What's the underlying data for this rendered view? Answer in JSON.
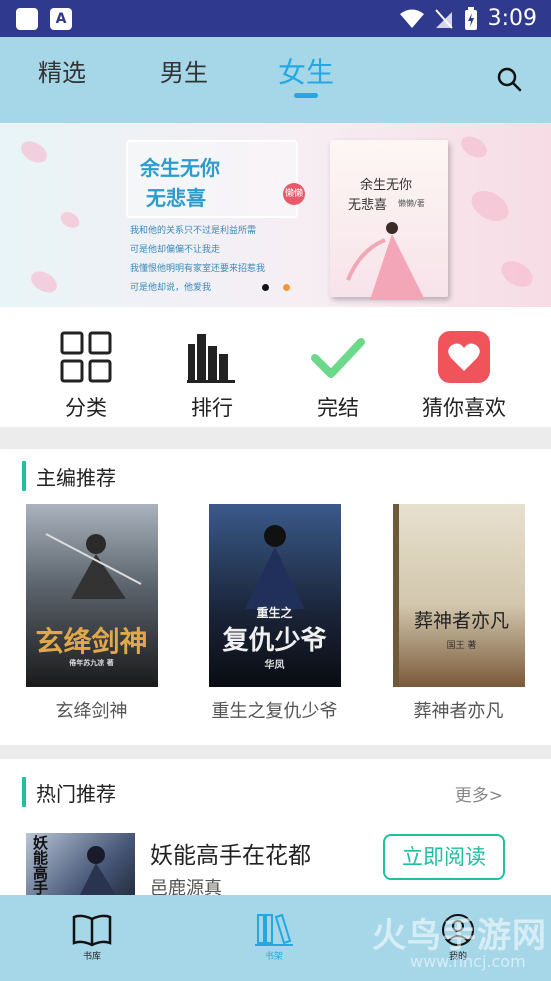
{
  "status_bar": {
    "time": "3:09",
    "app_icon_letter": "A"
  },
  "tabs": [
    {
      "label": "精选"
    },
    {
      "label": "男生"
    },
    {
      "label": "女生"
    }
  ],
  "banner": {
    "title_line1": "余生无你",
    "title_line2": "无悲喜",
    "author_badge": "懒懒",
    "blurb": [
      "我和他的关系只不过是利益所需",
      "可是他却偏偏不让我走",
      "我懂恨他明明有家室还要来招惹我",
      "可是他却说，他爱我"
    ],
    "cover_title1": "余生无你",
    "cover_title2": "无悲喜",
    "cover_author": "懒懒/著"
  },
  "quick_links": [
    {
      "label": "分类",
      "icon": "grid-icon"
    },
    {
      "label": "排行",
      "icon": "bar-chart-icon"
    },
    {
      "label": "完结",
      "icon": "checkmark-icon"
    },
    {
      "label": "猜你喜欢",
      "icon": "heart-icon"
    }
  ],
  "editor_picks": {
    "title": "主编推荐",
    "books": [
      {
        "name": "玄绛剑神",
        "cover_text": "玄绛剑神",
        "cover_author": "倦年苏九凉 著"
      },
      {
        "name": "重生之复仇少爷",
        "cover_text": "复仇少爷",
        "cover_subtext": "重生之",
        "cover_author": "华凤"
      },
      {
        "name": "葬神者亦凡",
        "cover_text": "葬神者亦凡",
        "cover_author": "国王 著"
      }
    ]
  },
  "hot_picks": {
    "title": "热门推荐",
    "more_label": "更多>",
    "item": {
      "name": "妖能高手在花都",
      "author": "邑鹿源真",
      "cover_text": "妖能高手",
      "read_button": "立即阅读"
    }
  },
  "bottom_nav": [
    {
      "label": "书库"
    },
    {
      "label": "书架"
    },
    {
      "label": "我的"
    }
  ],
  "watermark": {
    "text": "火鸟手游网",
    "url": "www.hncj.com"
  },
  "colors": {
    "accent": "#22a9e3",
    "bar": "#a6d7e8",
    "green": "#1fbfa0",
    "status": "#2f3a8f"
  }
}
